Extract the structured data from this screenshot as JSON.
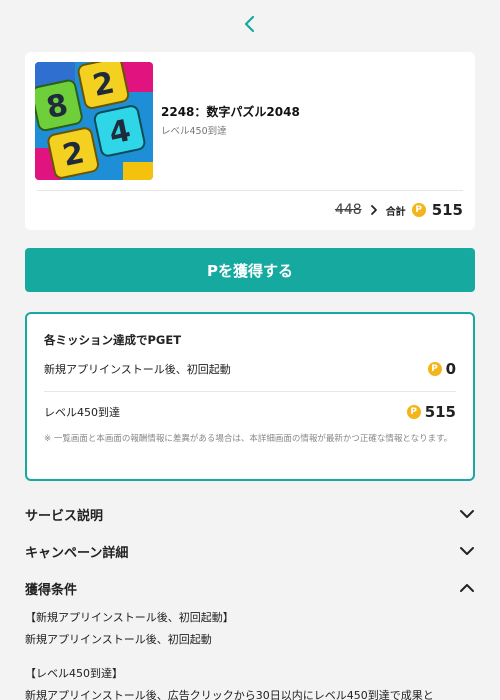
{
  "header": {
    "back_icon": "chevron-left-icon"
  },
  "app": {
    "title": "2248：数字パズル2048",
    "subtitle": "レベル450到達",
    "icon_digits": [
      "8",
      "2",
      "2",
      "4"
    ],
    "old_points": "448",
    "total_label": "合計",
    "coin_symbol": "P",
    "total_points": "515"
  },
  "cta": {
    "label": "Pを獲得する"
  },
  "missions": {
    "title": "各ミッション達成でPGET",
    "items": [
      {
        "label": "新規アプリインストール後、初回起動",
        "points": "0"
      },
      {
        "label": "レベル450到達",
        "points": "515"
      }
    ],
    "note": "※ 一覧画面と本画面の報酬情報に差異がある場合は、本詳細画面の情報が最新かつ正確な情報となります。"
  },
  "sections": [
    {
      "title": "サービス説明",
      "state": "collapsed"
    },
    {
      "title": "キャンペーン詳細",
      "state": "collapsed"
    },
    {
      "title": "獲得条件",
      "state": "expanded"
    }
  ],
  "conditions": {
    "c1_heading": "【新規アプリインストール後、初回起動】",
    "c1_body": "新規アプリインストール後、初回起動",
    "c2_heading": "【レベル450到達】",
    "c2_body": "新規アプリインストール後、広告クリックから30日以内にレベル450到達で成果と"
  },
  "colors": {
    "accent": "#15a9a0",
    "coin": "#f2b51a",
    "background": "#f3f3f3"
  }
}
